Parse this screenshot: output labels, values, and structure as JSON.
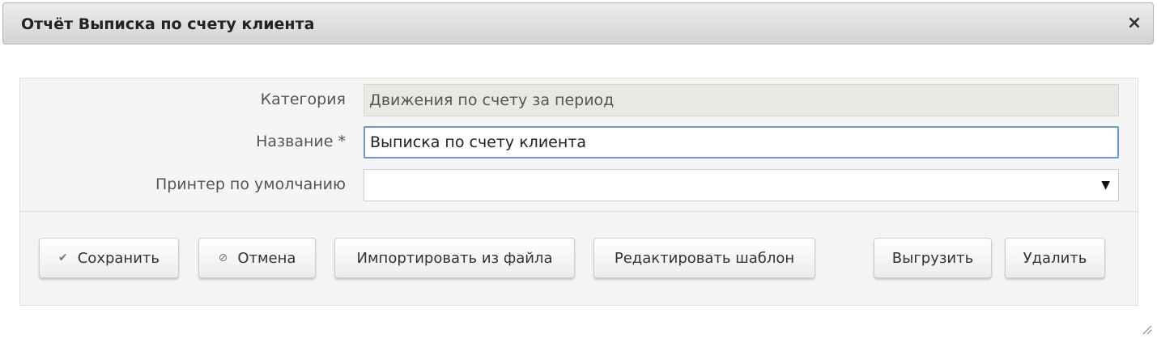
{
  "dialog": {
    "title": "Отчёт Выписка по счету клиента",
    "close_icon": "×"
  },
  "form": {
    "category": {
      "label": "Категория",
      "value": "Движения по счету за период"
    },
    "name": {
      "label": "Название *",
      "value": "Выписка по счету клиента"
    },
    "printer": {
      "label": "Принтер по умолчанию",
      "value": "",
      "caret": "▼"
    }
  },
  "buttons": {
    "save": {
      "label": "Сохранить",
      "icon": "✔"
    },
    "cancel": {
      "label": "Отмена",
      "icon": "⊘"
    },
    "import": {
      "label": "Импортировать из файла"
    },
    "edit_template": {
      "label": "Редактировать шаблон"
    },
    "export": {
      "label": "Выгрузить"
    },
    "delete": {
      "label": "Удалить"
    }
  },
  "colors": {
    "title_bar": "#d9d9d9",
    "focus_border": "#6d96c9",
    "readonly_bg": "#e9e9e3"
  }
}
